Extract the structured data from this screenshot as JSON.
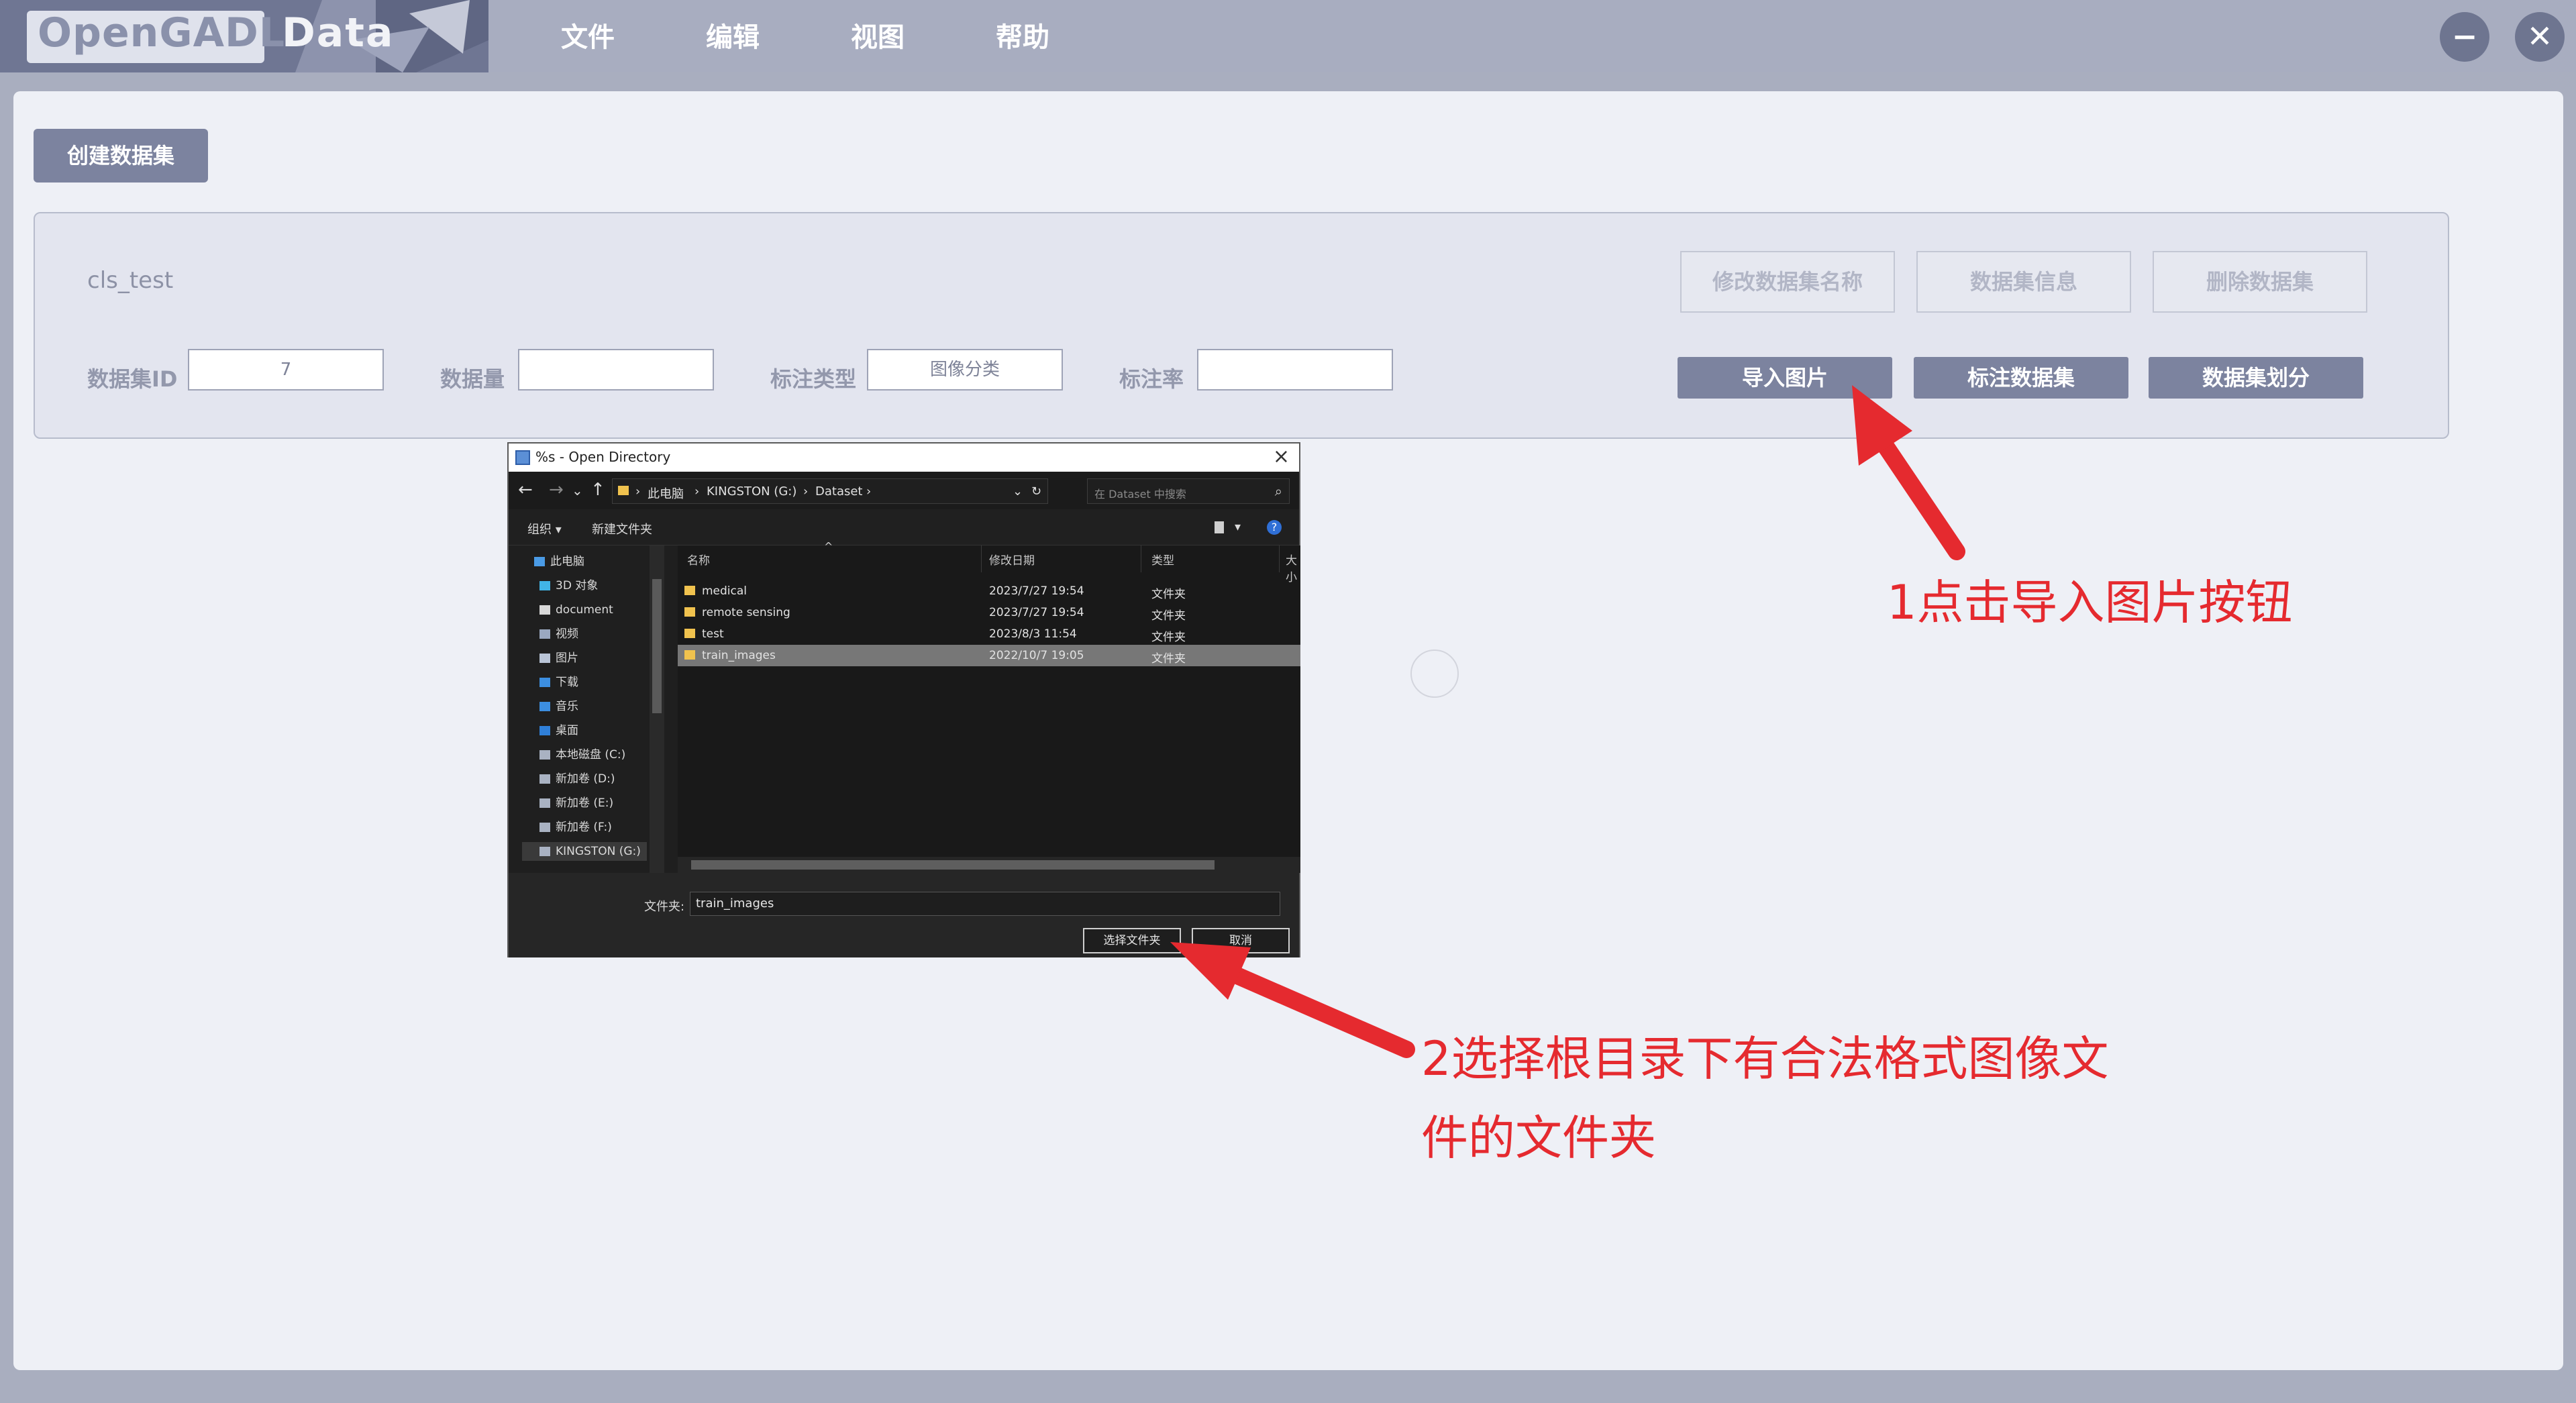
{
  "app": {
    "logo_main": "OpenGADL",
    "logo_sub": "Data"
  },
  "menu": [
    "文件",
    "编辑",
    "视图",
    "帮助"
  ],
  "window_buttons": {
    "minimize": "−",
    "close": "✕"
  },
  "create_button": "创建数据集",
  "dataset": {
    "name": "cls_test",
    "fields": {
      "id_label": "数据集ID",
      "id_value": "7",
      "count_label": "数据量",
      "count_value": "",
      "type_label": "标注类型",
      "type_value": "图像分类",
      "rate_label": "标注率",
      "rate_value": ""
    },
    "top_buttons": [
      "修改数据集名称",
      "数据集信息",
      "删除数据集"
    ],
    "action_buttons": [
      "导入图片",
      "标注数据集",
      "数据集划分"
    ]
  },
  "dialog": {
    "title": "%s - Open Directory",
    "breadcrumb": [
      "此电脑",
      "KINGSTON (G:)",
      "Dataset"
    ],
    "search_placeholder": "在 Dataset 中搜索",
    "toolbar": {
      "organize": "组织 ▾",
      "new_folder": "新建文件夹"
    },
    "nav_items": [
      "此电脑",
      "3D 对象",
      "document",
      "视频",
      "图片",
      "下载",
      "音乐",
      "桌面",
      "本地磁盘 (C:)",
      "新加卷 (D:)",
      "新加卷 (E:)",
      "新加卷 (F:)",
      "KINGSTON (G:)"
    ],
    "columns": [
      "名称",
      "修改日期",
      "类型",
      "大小"
    ],
    "files": [
      {
        "name": "medical",
        "date": "2023/7/27 19:54",
        "type": "文件夹"
      },
      {
        "name": "remote sensing",
        "date": "2023/7/27 19:54",
        "type": "文件夹"
      },
      {
        "name": "test",
        "date": "2023/8/3 11:54",
        "type": "文件夹"
      },
      {
        "name": "train_images",
        "date": "2022/10/7 19:05",
        "type": "文件夹"
      }
    ],
    "folder_label": "文件夹:",
    "folder_value": "train_images",
    "select_button": "选择文件夹",
    "cancel_button": "取消"
  },
  "annotations": {
    "step1": "1点击导入图片按钮",
    "step2_line1": "2选择根目录下有合法格式图像文",
    "step2_line2": "件的文件夹"
  },
  "colors": {
    "accent": "#7c839f",
    "annotation_red": "#e52a2f",
    "topbar": "#a8adc0"
  }
}
